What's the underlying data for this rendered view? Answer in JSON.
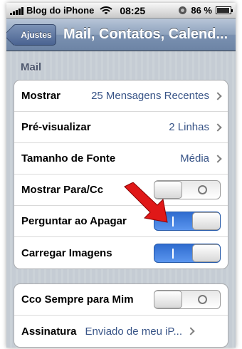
{
  "statusbar": {
    "carrier": "Blog do iPhone",
    "time": "08:25",
    "battery": "86 %"
  },
  "navbar": {
    "back_label": "Ajustes",
    "title": "Mail, Contatos, Calend..."
  },
  "section": {
    "header": "Mail"
  },
  "group1": [
    {
      "label": "Mostrar",
      "value": "25 Mensagens Recentes",
      "type": "disclosure"
    },
    {
      "label": "Pré-visualizar",
      "value": "2 Linhas",
      "type": "disclosure"
    },
    {
      "label": "Tamanho de Fonte",
      "value": "Média",
      "type": "disclosure"
    },
    {
      "label": "Mostrar Para/Cc",
      "type": "switch",
      "on": false
    },
    {
      "label": "Perguntar ao Apagar",
      "type": "switch",
      "on": true
    },
    {
      "label": "Carregar Imagens",
      "type": "switch",
      "on": true
    }
  ],
  "group2": [
    {
      "label": "Cco Sempre para Mim",
      "type": "switch",
      "on": false
    },
    {
      "label": "Assinatura",
      "value": "Enviado de meu iP...",
      "type": "disclosure"
    }
  ],
  "colors": {
    "switch_on": "#3a77d9",
    "value_text": "#385487",
    "annotation_arrow": "#e01818"
  },
  "icons": [
    "signal-bars-icon",
    "wifi-icon",
    "orientation-lock-icon",
    "battery-icon",
    "chevron-right-icon",
    "red-arrow-annotation"
  ]
}
